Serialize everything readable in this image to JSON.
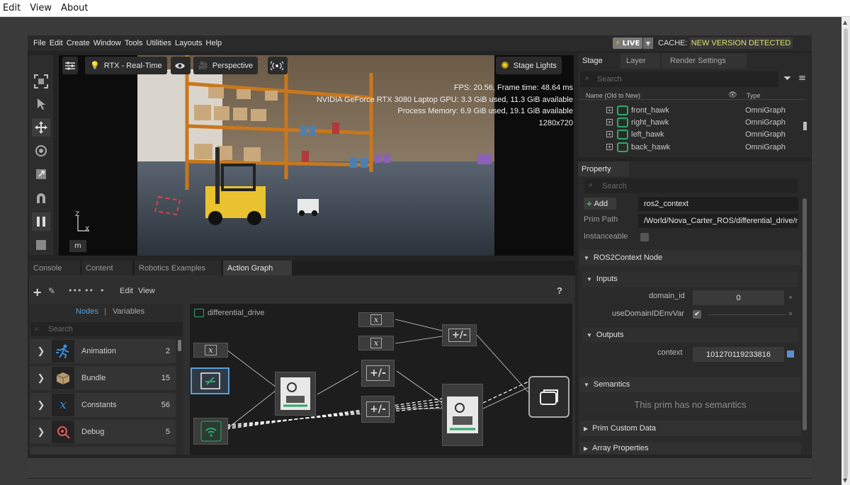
{
  "browser_menu": [
    "Edit",
    "View",
    "About"
  ],
  "app_menu": [
    "File",
    "Edit",
    "Create",
    "Window",
    "Tools",
    "Utilities",
    "Layouts",
    "Help"
  ],
  "live_label": "LIVE",
  "cache_label": "CACHE:",
  "cache_status": "NEW VERSION DETECTED",
  "viewport": {
    "render_mode": "RTX - Real-Time",
    "camera": "Perspective",
    "stage_lights": "Stage Lights",
    "stats": [
      "FPS: 20.56, Frame time: 48.64 ms",
      "NVIDIA GeForce RTX 3080 Laptop GPU: 3.3 GiB used, 11.3 GiB available",
      "Process Memory: 6.9 GiB used, 19.1 GiB available",
      "1280x720"
    ],
    "axis_z": "Z",
    "axis_x": "X",
    "unit": "m"
  },
  "bottom_tabs": [
    "Console",
    "Content",
    "Robotics Examples",
    "Action Graph"
  ],
  "graph": {
    "menu_edit": "Edit",
    "menu_view": "View",
    "help": "?",
    "nodes_tab": "Nodes",
    "separator": "|",
    "variables_tab": "Variables",
    "search_placeholder": "Search",
    "graph_name": "differential_drive",
    "categories": [
      {
        "label": "Animation",
        "count": "2"
      },
      {
        "label": "Bundle",
        "count": "15"
      },
      {
        "label": "Constants",
        "count": "56"
      },
      {
        "label": "Debug",
        "count": "5"
      }
    ],
    "node_glyphs": {
      "const": "x",
      "op": "+/-"
    }
  },
  "stage": {
    "tabs": [
      "Stage",
      "Layer",
      "Render Settings"
    ],
    "search_placeholder": "Search",
    "col_name": "Name (Old to New)",
    "col_type": "Type",
    "rows": [
      {
        "name": "front_hawk",
        "type": "OmniGraph"
      },
      {
        "name": "right_hawk",
        "type": "OmniGraph"
      },
      {
        "name": "left_hawk",
        "type": "OmniGraph"
      },
      {
        "name": "back_hawk",
        "type": "OmniGraph"
      }
    ]
  },
  "property": {
    "tab": "Property",
    "search_placeholder": "Search",
    "add_label": "Add",
    "prim_name": "ros2_context",
    "prim_path_label": "Prim Path",
    "prim_path": "/World/Nova_Carter_ROS/differential_drive/r",
    "instanceable_label": "Instanceable",
    "node_section": "ROS2Context Node",
    "inputs_label": "Inputs",
    "domain_id_label": "domain_id",
    "domain_id": "0",
    "use_domain_label": "useDomainIDEnvVar",
    "outputs_label": "Outputs",
    "context_label": "context",
    "context_value": "101270119233816",
    "semantics_label": "Semantics",
    "semantics_empty": "This prim has no semantics",
    "custom_data_label": "Prim Custom Data",
    "array_props_label": "Array Properties"
  },
  "colors": {
    "accent_green": "#2ea86b",
    "cache_text": "#d9e36a",
    "selection_blue": "#5aa0d8"
  }
}
